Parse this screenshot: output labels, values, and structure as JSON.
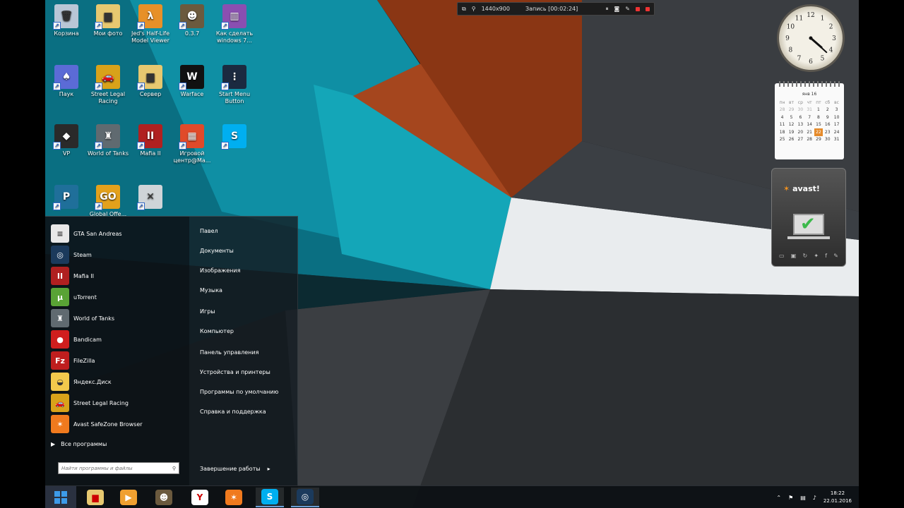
{
  "recorder": {
    "resolution": "1440x900",
    "status": "Запись [00:02:24]"
  },
  "desktop_icons": [
    {
      "label": "Корзина",
      "icon": "recycle-bin-icon",
      "color": "#b9c6d6"
    },
    {
      "label": "Мои фото",
      "icon": "folder-icon",
      "color": "#e7c870"
    },
    {
      "label": "Jed's Half-Life Model Viewer",
      "icon": "halflife-icon",
      "color": "#e79028"
    },
    {
      "label": "0.3.7",
      "icon": "gta-samp-icon",
      "color": "#6b5a3e"
    },
    {
      "label": "Как сделать windows 7...",
      "icon": "winrar-icon",
      "color": "#8a4fb1"
    },
    {
      "label": "Паук",
      "icon": "spider-solitaire-icon",
      "color": "#5b6bd6"
    },
    {
      "label": "Street Legal Racing",
      "icon": "car-icon",
      "color": "#d8a21a"
    },
    {
      "label": "Сервер",
      "icon": "folder-icon",
      "color": "#e7c870"
    },
    {
      "label": "Warface",
      "icon": "warface-icon",
      "color": "#111111"
    },
    {
      "label": "Start Menu Button",
      "icon": "start-menu-button-icon",
      "color": "#1b2a40"
    },
    {
      "label": "VP",
      "icon": "vp-icon",
      "color": "#2a2a2a"
    },
    {
      "label": "World of Tanks",
      "icon": "world-of-tanks-icon",
      "color": "#606a70"
    },
    {
      "label": "Mafia II",
      "icon": "mafia-icon",
      "color": "#b02020"
    },
    {
      "label": "Игровой центр@Ma...",
      "icon": "rubik-cube-icon",
      "color": "#e04a2a"
    },
    {
      "label": "",
      "icon": "skype-icon",
      "color": "#00aff0"
    },
    {
      "label": "",
      "icon": "p-app-icon",
      "color": "#1f6f9a"
    },
    {
      "label": "Global Offe...",
      "icon": "csgo-icon",
      "color": "#e3a11c"
    },
    {
      "label": "",
      "icon": "counter-strike-icon",
      "color": "#cfd4d8"
    }
  ],
  "start_menu": {
    "programs": [
      {
        "label": "GTA San Andreas",
        "icon": "document-icon",
        "color": "#e8e8e8"
      },
      {
        "label": "Steam",
        "icon": "steam-icon",
        "color": "#1b3a5c"
      },
      {
        "label": "Mafia II",
        "icon": "mafia-icon",
        "color": "#b02020"
      },
      {
        "label": "uTorrent",
        "icon": "utorrent-icon",
        "color": "#59a335"
      },
      {
        "label": "World of Tanks",
        "icon": "world-of-tanks-icon",
        "color": "#606a70"
      },
      {
        "label": "Bandicam",
        "icon": "bandicam-icon",
        "color": "#d01e1e"
      },
      {
        "label": "FileZilla",
        "icon": "filezilla-icon",
        "color": "#bf1e1e"
      },
      {
        "label": "Яндекс.Диск",
        "icon": "yandex-disk-icon",
        "color": "#f2c94c"
      },
      {
        "label": "Street Legal Racing",
        "icon": "car-icon",
        "color": "#d8a21a"
      },
      {
        "label": "Avast SafeZone Browser",
        "icon": "avast-browser-icon",
        "color": "#f07a1e"
      }
    ],
    "all_programs": "Все программы",
    "search_placeholder": "Найти программы и файлы",
    "right_links": [
      "Павел",
      "Документы",
      "Изображения",
      "Музыка",
      "Игры",
      "Компьютер",
      "Панель управления",
      "Устройства и принтеры",
      "Программы по умолчанию",
      "Справка и поддержка"
    ],
    "shutdown": "Завершение работы"
  },
  "calendar": {
    "month": "янв 16",
    "weekdays": [
      "пн",
      "вт",
      "ср",
      "чт",
      "пт",
      "сб",
      "вс"
    ],
    "rows": [
      [
        "28",
        "29",
        "30",
        "31",
        "1",
        "2",
        "3"
      ],
      [
        "4",
        "5",
        "6",
        "7",
        "8",
        "9",
        "10"
      ],
      [
        "11",
        "12",
        "13",
        "14",
        "15",
        "16",
        "17"
      ],
      [
        "18",
        "19",
        "20",
        "21",
        "22",
        "23",
        "24"
      ],
      [
        "25",
        "26",
        "27",
        "28",
        "29",
        "30",
        "31"
      ]
    ],
    "today": "22"
  },
  "avast": {
    "brand_prefix": "",
    "brand": "avast!"
  },
  "taskbar": {
    "apps": [
      {
        "name": "explorer",
        "icon": "folder-icon",
        "color": "#e7c870"
      },
      {
        "name": "media-player",
        "icon": "media-player-icon",
        "color": "#f0a030"
      },
      {
        "name": "gta",
        "icon": "gta-icon",
        "color": "#6b5a3e"
      },
      {
        "name": "yandex",
        "icon": "yandex-browser-icon",
        "color": "#ffffff"
      },
      {
        "name": "avast",
        "icon": "avast-icon",
        "color": "#f07a1e"
      },
      {
        "name": "skype",
        "icon": "skype-icon",
        "color": "#00aff0"
      },
      {
        "name": "steam",
        "icon": "steam-icon",
        "color": "#1b3a5c"
      }
    ],
    "time": "18:22",
    "date": "22.01.2016"
  },
  "clock": {
    "hour": 4,
    "minute": 22
  }
}
